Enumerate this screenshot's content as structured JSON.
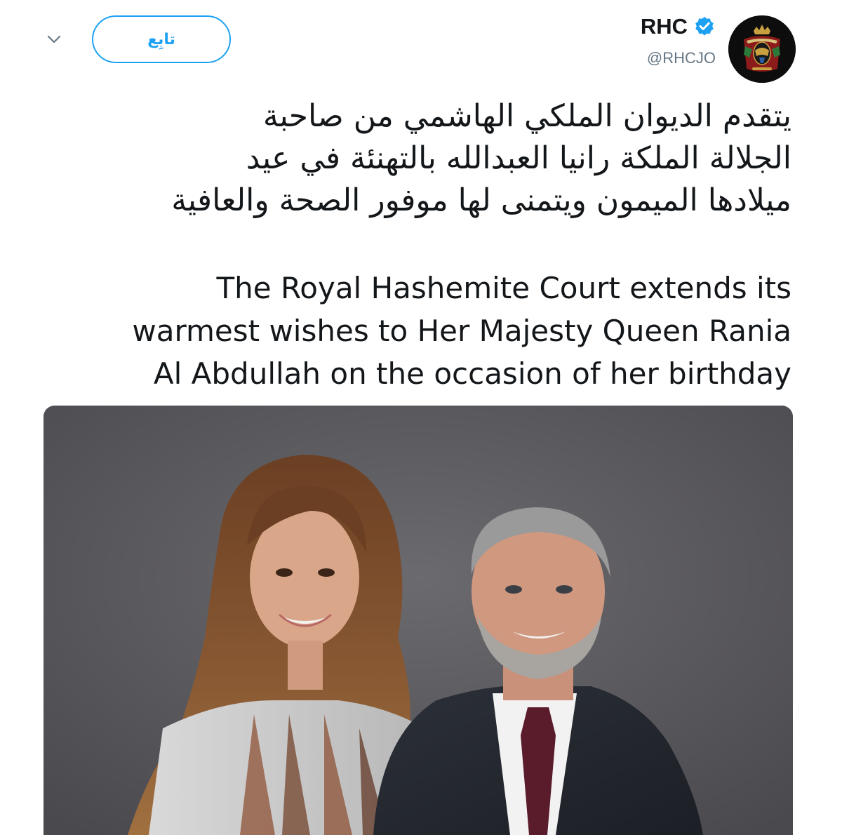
{
  "header": {
    "name": "RHC",
    "handle": "@RHCJO",
    "follow_label": "تابِع",
    "icons": {
      "avatar": "royal-crest-icon",
      "verified": "verified-badge-icon",
      "caret": "chevron-down-icon"
    },
    "verified_color": "#1da1f2"
  },
  "tweet": {
    "arabic_lines": [
      "يتقدم الديوان الملكي الهاشمي من صاحبة",
      "الجلالة الملكة رانيا العبدالله بالتهنئة في عيد",
      "ميلادها الميمون ويتمنى لها موفور الصحة والعافية"
    ],
    "english_lines": [
      "The Royal Hashemite Court extends its",
      "warmest wishes to Her Majesty Queen Rania",
      "Al Abdullah on the occasion of her birthday"
    ]
  },
  "media": {
    "type": "photo",
    "accent_colors": {
      "background": "#5b5a5e",
      "accent": "#1da1f2"
    }
  }
}
